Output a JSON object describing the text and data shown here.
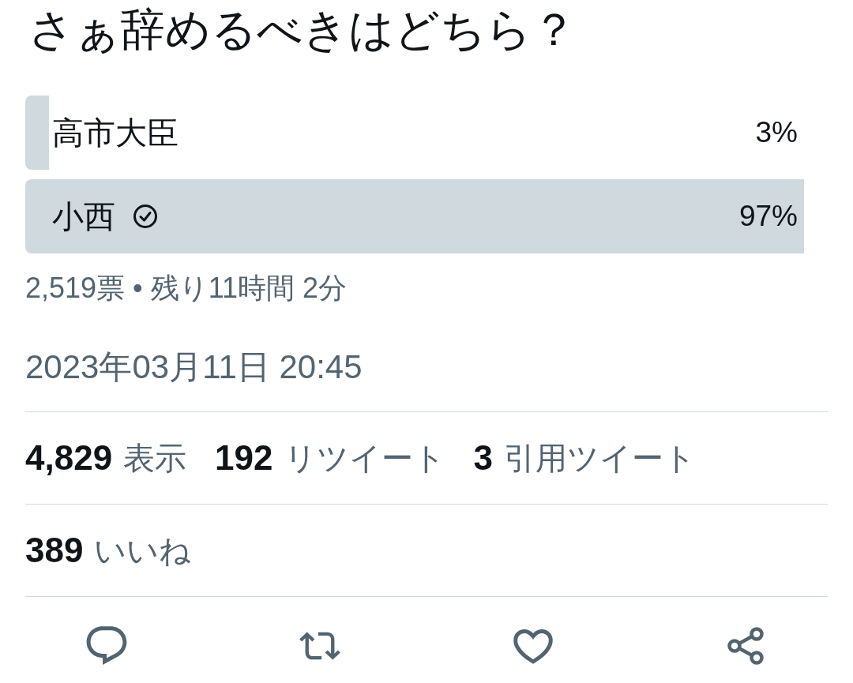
{
  "poll": {
    "question": "さぁ辞めるべきはどちら？",
    "options": [
      {
        "label": "高市大臣",
        "percent": "3%",
        "level": 0.03,
        "selected": false
      },
      {
        "label": "小西",
        "percent": "97%",
        "level": 0.97,
        "selected": true
      }
    ],
    "summary": "2,519票 • 残り11時間 2分"
  },
  "timestamp": "2023年03月11日 20:45",
  "stat_rows": [
    {
      "items": [
        {
          "count": "4,829",
          "label": "表示"
        },
        {
          "count": "192",
          "label": "リツイート"
        },
        {
          "count": "3",
          "label": "引用ツイート"
        }
      ]
    },
    {
      "items": [
        {
          "count": "389",
          "label": "いいね"
        }
      ]
    }
  ]
}
